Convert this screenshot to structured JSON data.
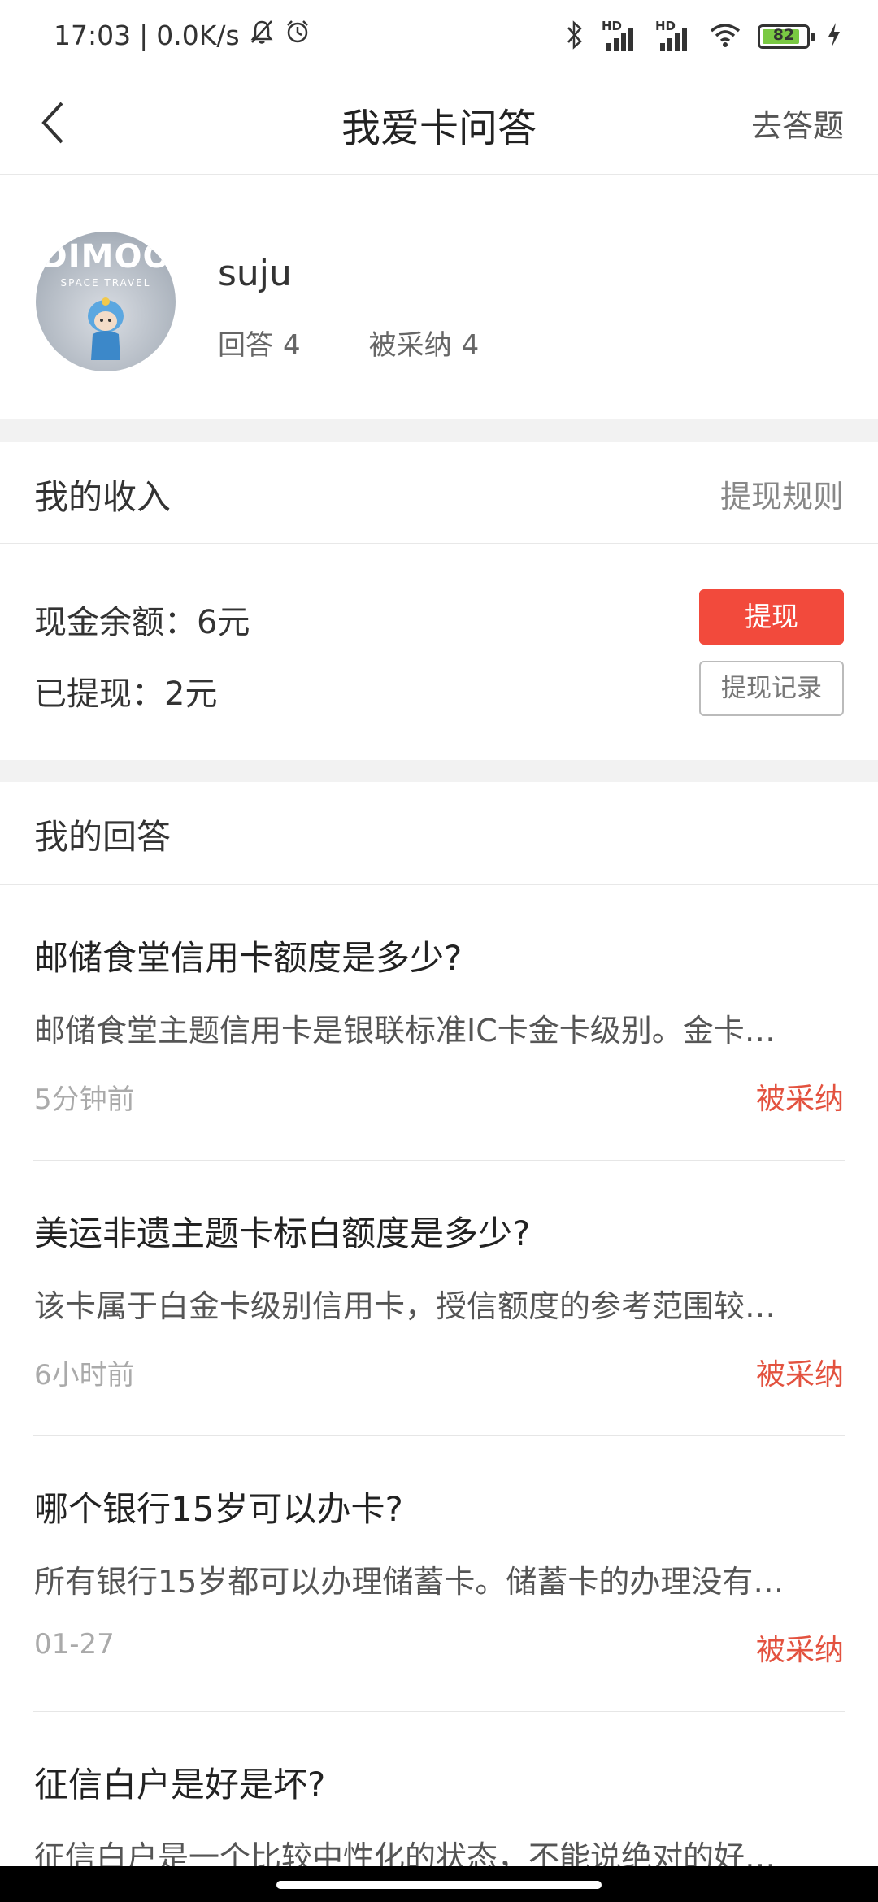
{
  "status_bar": {
    "time": "17:03",
    "separator": "|",
    "network_speed": "0.0K/s",
    "battery": "82",
    "hd_label": "HD"
  },
  "nav": {
    "title": "我爱卡问答",
    "action": "去答题"
  },
  "profile": {
    "username": "suju",
    "avatar_brand": "DIMOO",
    "avatar_tagline": "SPACE TRAVEL",
    "answers_label": "回答",
    "answers_count": "4",
    "adopted_label": "被采纳",
    "adopted_count": "4"
  },
  "income": {
    "title": "我的收入",
    "rules_link": "提现规则",
    "balance": "现金余额：6元",
    "withdrawn": "已提现：2元",
    "withdraw_button": "提现",
    "records_button": "提现记录"
  },
  "answers": {
    "title": "我的回答",
    "items": [
      {
        "question": "邮储食堂信用卡额度是多少?",
        "answer": "邮储食堂主题信用卡是银联标准IC卡金卡级别。金卡…",
        "time": "5分钟前",
        "badge": "被采纳"
      },
      {
        "question": "美运非遗主题卡标白额度是多少?",
        "answer": "该卡属于白金卡级别信用卡，授信额度的参考范围较…",
        "time": "6小时前",
        "badge": "被采纳"
      },
      {
        "question": "哪个银行15岁可以办卡?",
        "answer": "所有银行15岁都可以办理储蓄卡。储蓄卡的办理没有…",
        "time": "01-27",
        "badge": "被采纳"
      },
      {
        "question": "征信白户是好是坏?",
        "answer": "征信白户是一个比较中性化的状态，不能说绝对的好…",
        "time": "",
        "badge": ""
      }
    ]
  },
  "colors": {
    "accent_red": "#f24a3c",
    "badge_red": "#e3523f",
    "battery_green": "#7ac943"
  }
}
